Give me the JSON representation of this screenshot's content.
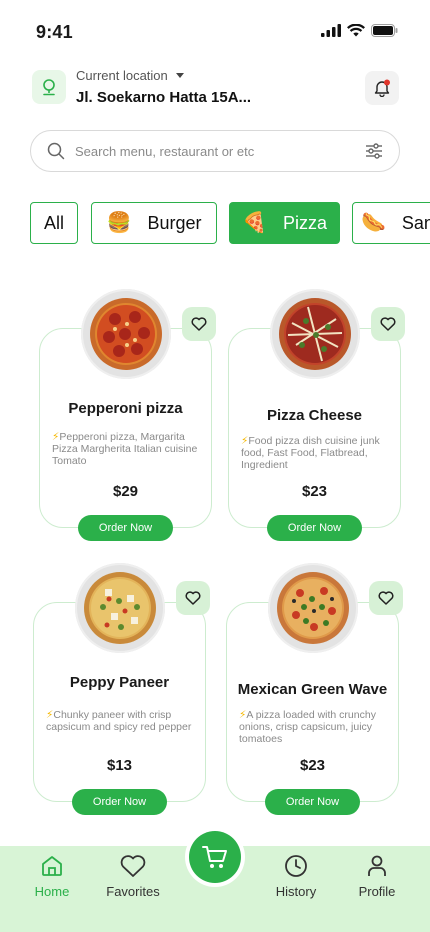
{
  "status": {
    "time": "9:41"
  },
  "location": {
    "label": "Current location",
    "value": "Jl. Soekarno Hatta 15A..."
  },
  "search": {
    "placeholder": "Search menu, restaurant or etc"
  },
  "categories": [
    {
      "label": "All",
      "emoji": "",
      "active": false
    },
    {
      "label": "Burger",
      "emoji": "🍔",
      "active": false
    },
    {
      "label": "Pizza",
      "emoji": "🍕",
      "active": true
    },
    {
      "label": "Sandwich",
      "emoji": "🌭",
      "active": false
    }
  ],
  "products": [
    {
      "name": "Pepperoni pizza",
      "desc": "Pepperoni pizza, Margarita Pizza Margherita Italian cuisine Tomato",
      "price": "$29",
      "order_label": "Order Now"
    },
    {
      "name": "Pizza Cheese",
      "desc": "Food pizza dish cuisine junk food, Fast Food, Flatbread, Ingredient",
      "price": "$23",
      "order_label": "Order Now"
    },
    {
      "name": "Peppy Paneer",
      "desc": "Chunky paneer with crisp capsicum and spicy red pepper",
      "price": "$13",
      "order_label": "Order Now"
    },
    {
      "name": "Mexican Green Wave",
      "desc": "A pizza loaded with crunchy onions, crisp capsicum, juicy tomatoes",
      "price": "$23",
      "order_label": "Order Now"
    }
  ],
  "nav": {
    "home": "Home",
    "favorites": "Favorites",
    "history": "History",
    "profile": "Profile"
  },
  "colors": {
    "accent": "#2bb04a",
    "accent_light": "#d8f4d6",
    "fav_bg": "#d7f1d6",
    "bolt": "#f6b800"
  }
}
